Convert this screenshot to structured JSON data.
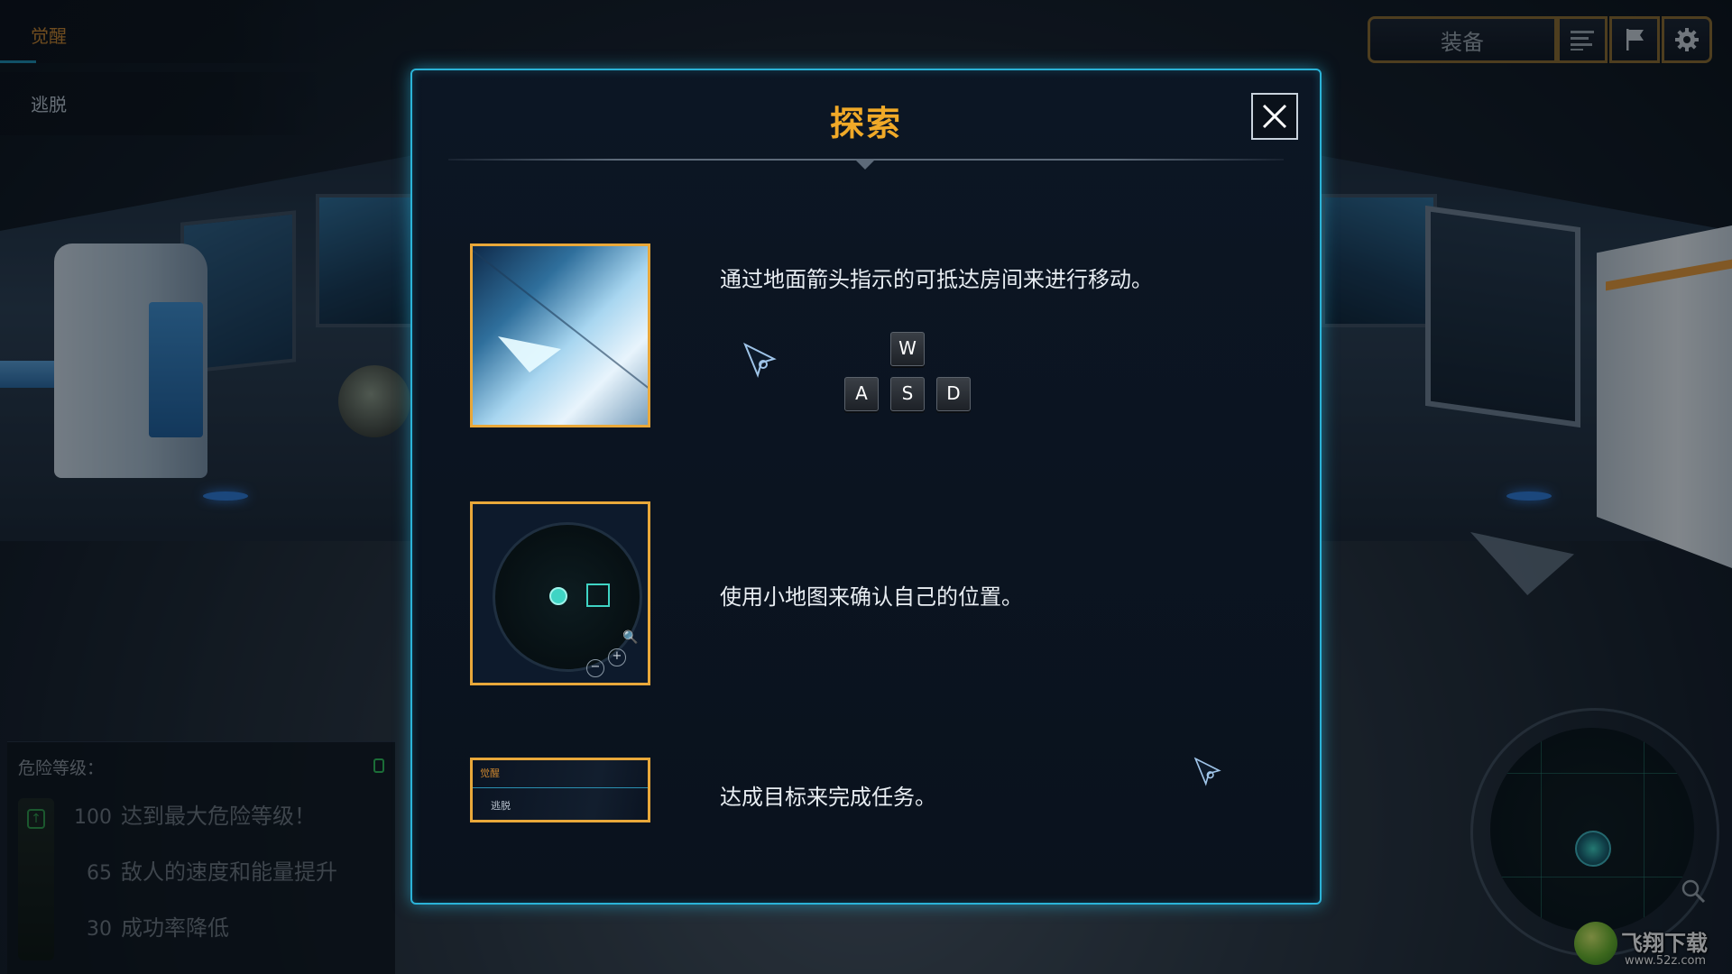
{
  "objectives": {
    "current": "觉醒",
    "next": "逃脱"
  },
  "hud": {
    "equip_label": "装备",
    "icons": [
      "menu-icon",
      "flag-icon",
      "gear-icon"
    ]
  },
  "modal": {
    "title": "探索",
    "close_icon": "close-icon",
    "tips": [
      {
        "text": "通过地面箭头指示的可抵达房间来进行移动。",
        "image": "floor-arrow-preview",
        "keys": [
          "W",
          "A",
          "S",
          "D"
        ]
      },
      {
        "text": "使用小地图来确认自己的位置。",
        "image": "minimap-preview",
        "thumb_labels": {
          "zoom": "🔍",
          "minus": "−",
          "plus": "+"
        }
      },
      {
        "text": "达成目标来完成任务。",
        "image": "objectives-preview",
        "thumb_labels": {
          "current": "觉醒",
          "next": "逃脱"
        }
      }
    ]
  },
  "danger": {
    "title": "危险等级：",
    "levels": [
      {
        "value": "100",
        "desc": "达到最大危险等级！"
      },
      {
        "value": "65",
        "desc": "敌人的速度和能量提升"
      },
      {
        "value": "30",
        "desc": "成功率降低"
      }
    ]
  },
  "watermark": {
    "text": "飞翔下载",
    "url": "www.52z.com"
  },
  "colors": {
    "title": "#f0a928",
    "modal_border": "#2bb3d8",
    "thumb_border": "#e9a83a",
    "objective_active": "#c7832e"
  }
}
